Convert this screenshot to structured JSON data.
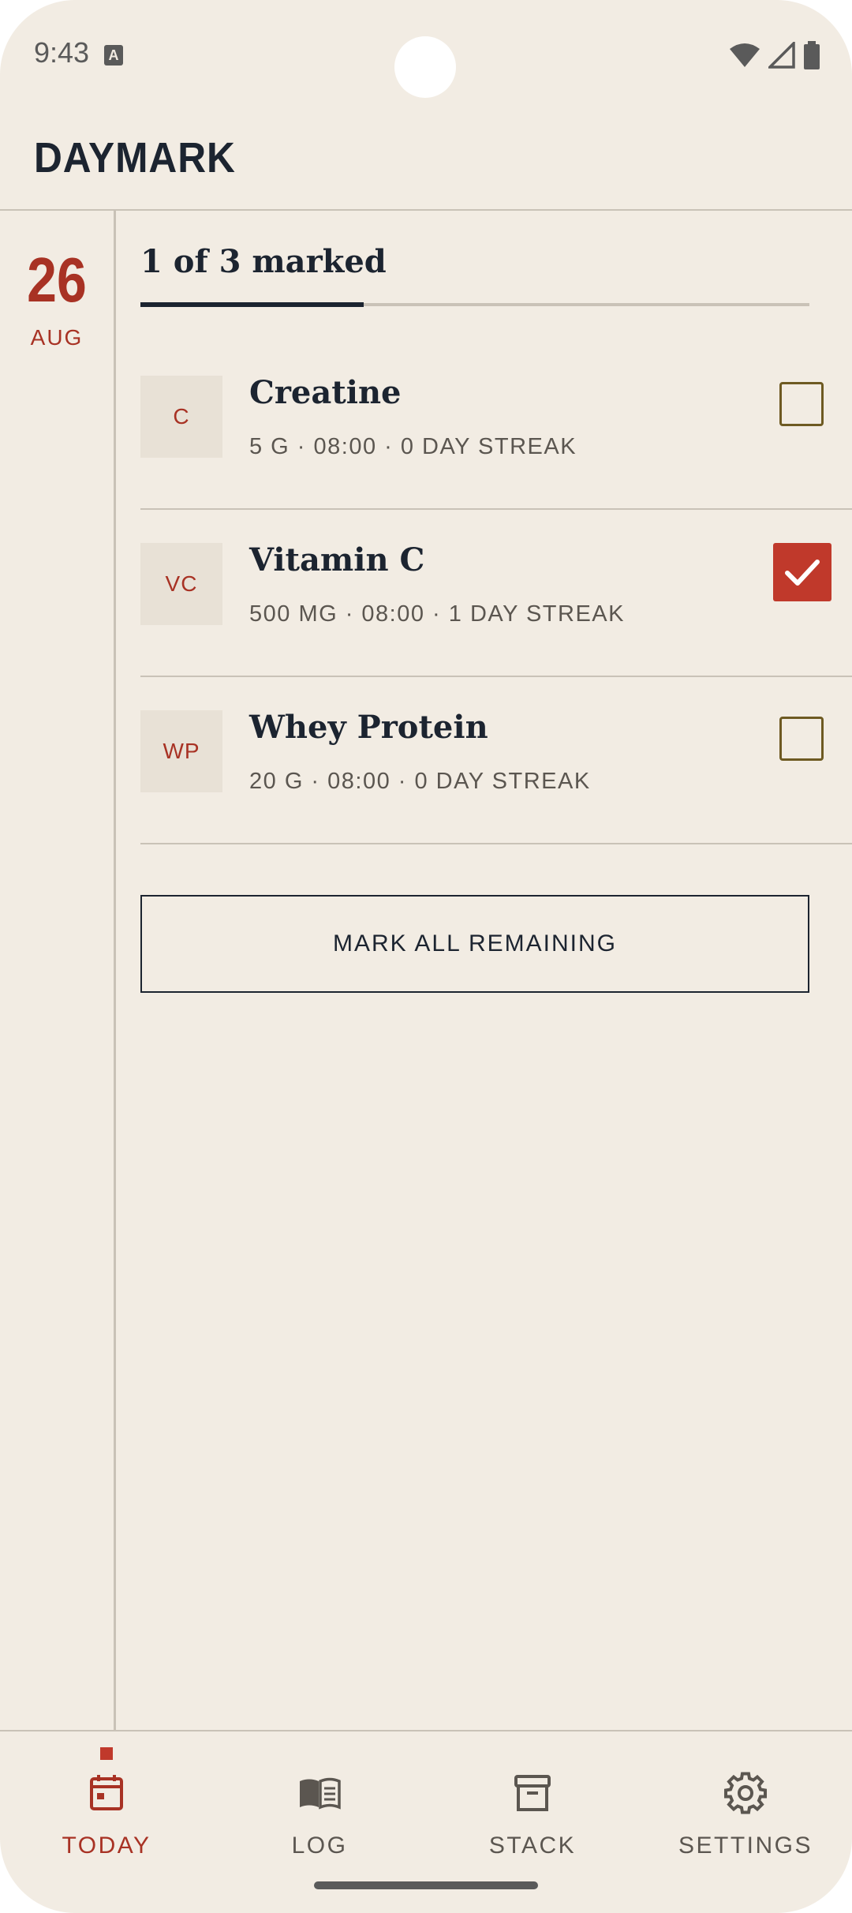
{
  "status_bar": {
    "time": "9:43",
    "notification_icon": "a-notification-icon",
    "icons": [
      "wifi-icon",
      "signal-icon",
      "battery-icon"
    ]
  },
  "app": {
    "title": "DAYMARK"
  },
  "date": {
    "day": "26",
    "month": "AUG"
  },
  "progress": {
    "label": "1 of 3 marked",
    "marked": 1,
    "total": 3
  },
  "items": [
    {
      "badge": "C",
      "name": "Creatine",
      "meta": "5 G · 08:00 · 0 DAY STREAK",
      "checked": false
    },
    {
      "badge": "VC",
      "name": "Vitamin C",
      "meta": "500 MG · 08:00 · 1 DAY STREAK",
      "checked": true
    },
    {
      "badge": "WP",
      "name": "Whey Protein",
      "meta": "20 G · 08:00 · 0 DAY STREAK",
      "checked": false
    }
  ],
  "actions": {
    "mark_all_label": "MARK ALL REMAINING"
  },
  "nav": [
    {
      "label": "TODAY",
      "icon": "calendar-icon",
      "active": true
    },
    {
      "label": "LOG",
      "icon": "book-icon",
      "active": false
    },
    {
      "label": "STACK",
      "icon": "archive-box-icon",
      "active": false
    },
    {
      "label": "SETTINGS",
      "icon": "gear-icon",
      "active": false
    }
  ],
  "colors": {
    "background": "#f2ece3",
    "accent": "#c0392b",
    "accent_text": "#a83224",
    "ink": "#1c2430",
    "muted": "#5b5650",
    "divider": "#c9c2b7"
  }
}
